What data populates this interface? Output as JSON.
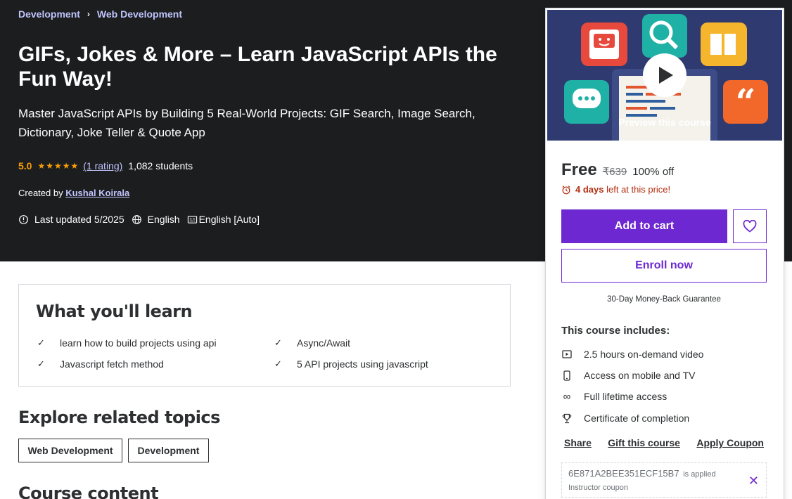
{
  "breadcrumb": [
    {
      "label": "Development"
    },
    {
      "label": "Web Development"
    }
  ],
  "course": {
    "title": "GIFs, Jokes & More – Learn JavaScript APIs the Fun Way!",
    "subtitle": "Master JavaScript APIs by Building 5 Real-World Projects: GIF Search, Image Search, Dictionary, Joke Teller & Quote App",
    "rating_value": "5.0",
    "stars": 5,
    "rating_count": "(1 rating)",
    "students": "1,082 students",
    "created_by_label": "Created by",
    "instructor": "Kushal Koirala",
    "last_updated": "Last updated 5/2025",
    "language": "English",
    "captions": "English [Auto]"
  },
  "learn": {
    "title": "What you'll learn",
    "items": [
      "learn how to build projects using api",
      "Async/Await",
      "Javascript fetch method",
      "5 API projects using javascript"
    ]
  },
  "explore": {
    "title": "Explore related topics",
    "topics": [
      "Web Development",
      "Development"
    ]
  },
  "content": {
    "title": "Course content"
  },
  "sidebar": {
    "preview_label": "Preview this course",
    "price": "Free",
    "original_price": "₹639",
    "discount": "100% off",
    "timer_bold": "4 days",
    "timer_rest": "left at this price!",
    "add_to_cart": "Add to cart",
    "enroll": "Enroll now",
    "guarantee": "30-Day Money-Back Guarantee",
    "includes_title": "This course includes:",
    "includes": [
      {
        "icon": "video-icon",
        "label": "2.5 hours on-demand video"
      },
      {
        "icon": "mobile-icon",
        "label": "Access on mobile and TV"
      },
      {
        "icon": "infinity-icon",
        "label": "Full lifetime access"
      },
      {
        "icon": "trophy-icon",
        "label": "Certificate of completion"
      }
    ],
    "links": [
      "Share",
      "Gift this course",
      "Apply Coupon"
    ],
    "coupon_code": "6E871A2BEE351ECF15B7",
    "coupon_applied": "is applied",
    "coupon_sub": "Instructor coupon"
  },
  "colors": {
    "hero_bg": "#1c1d1f",
    "accent": "#6d28d2",
    "link_light": "#c0c4fc",
    "star": "#f69c08",
    "urgent": "#b32d0f"
  }
}
